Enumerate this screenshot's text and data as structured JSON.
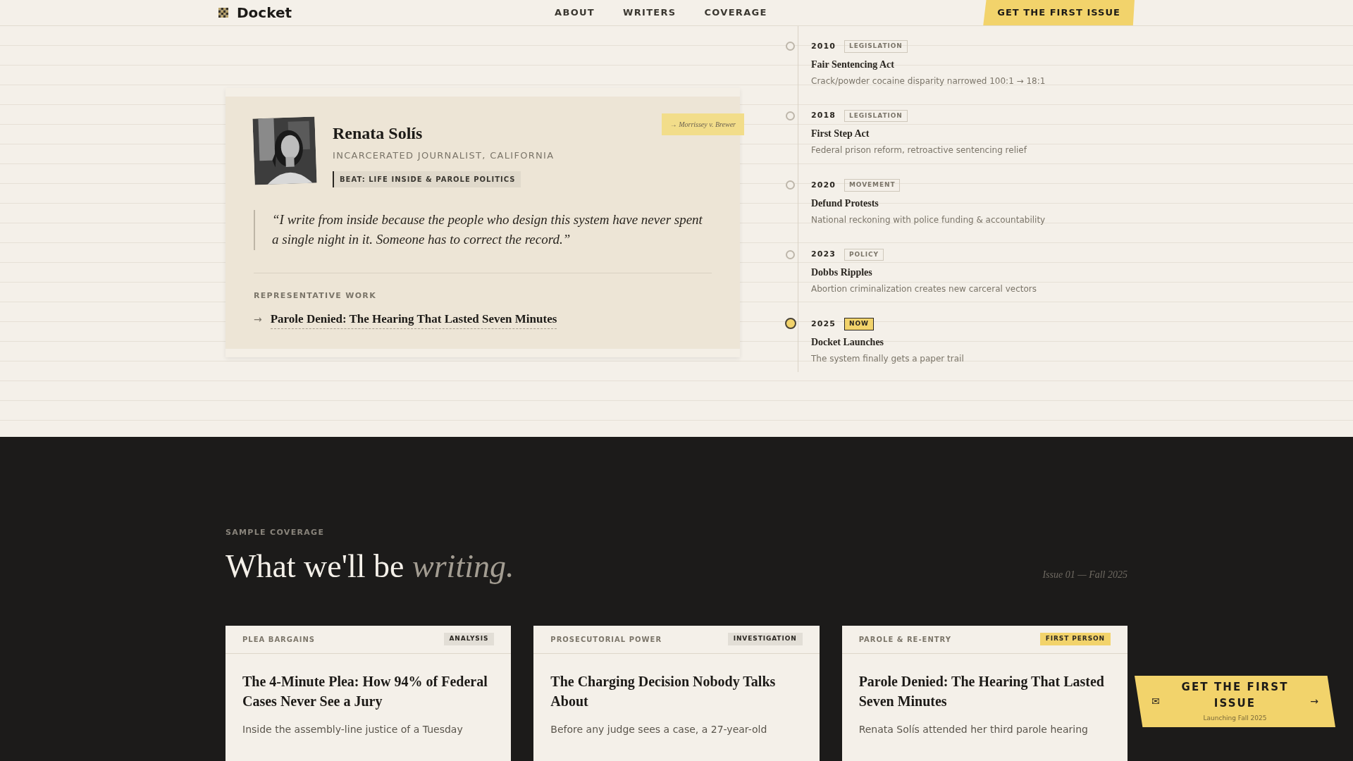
{
  "header": {
    "logo": "Docket",
    "nav": [
      "ABOUT",
      "WRITERS",
      "COVERAGE"
    ],
    "cta": "GET THE FIRST ISSUE"
  },
  "profile": {
    "name": "Renata Solís",
    "role": "INCARCERATED JOURNALIST, CALIFORNIA",
    "beat": "BEAT: LIFE INSIDE & PAROLE POLITICS",
    "note": "→ Morrissey v. Brewer",
    "quote": "“I write from inside because the people who design this system have never spent a single night in it. Someone has to correct the record.”",
    "work_label": "REPRESENTATIVE WORK",
    "work_arrow": "→",
    "work_title": "Parole Denied: The Hearing That Lasted Seven Minutes"
  },
  "timeline": [
    {
      "year": "2010",
      "tag": "LEGISLATION",
      "title": "Fair Sentencing Act",
      "desc": "Crack/powder cocaine disparity narrowed 100:1 → 18:1",
      "current": false
    },
    {
      "year": "2018",
      "tag": "LEGISLATION",
      "title": "First Step Act",
      "desc": "Federal prison reform, retroactive sentencing relief",
      "current": false
    },
    {
      "year": "2020",
      "tag": "MOVEMENT",
      "title": "Defund Protests",
      "desc": "National reckoning with police funding & accountability",
      "current": false
    },
    {
      "year": "2023",
      "tag": "POLICY",
      "title": "Dobbs Ripples",
      "desc": "Abortion criminalization creates new carceral vectors",
      "current": false
    },
    {
      "year": "2025",
      "tag": "NOW",
      "title": "Docket Launches",
      "desc": "The system finally gets a paper trail",
      "current": true
    }
  ],
  "coverage": {
    "label": "SAMPLE COVERAGE",
    "heading": "What we'll be",
    "heading_emphasis": "writing.",
    "issue": "Issue 01 — Fall 2025",
    "cards": [
      {
        "category": "PLEA BARGAINS",
        "tag": "ANALYSIS",
        "color": "#e2ded6",
        "title": "The 4-Minute Plea: How 94% of Federal Cases Never See a Jury",
        "excerpt": "Inside the assembly-line justice of a Tuesday"
      },
      {
        "category": "PROSECUTORIAL POWER",
        "tag": "INVESTIGATION",
        "color": "#e2ded6",
        "title": "The Charging Decision Nobody Talks About",
        "excerpt": "Before any judge sees a case, a 27-year-old"
      },
      {
        "category": "PAROLE & RE-ENTRY",
        "tag": "FIRST PERSON",
        "color": "#f2d36b",
        "title": "Parole Denied: The Hearing That Lasted Seven Minutes",
        "excerpt": "Renata Solís attended her third parole hearing"
      }
    ]
  },
  "floating_cta": {
    "icon": "✉",
    "label": "GET THE FIRST ISSUE",
    "sublabel": "Launching Fall 2025",
    "arrow": "→"
  }
}
